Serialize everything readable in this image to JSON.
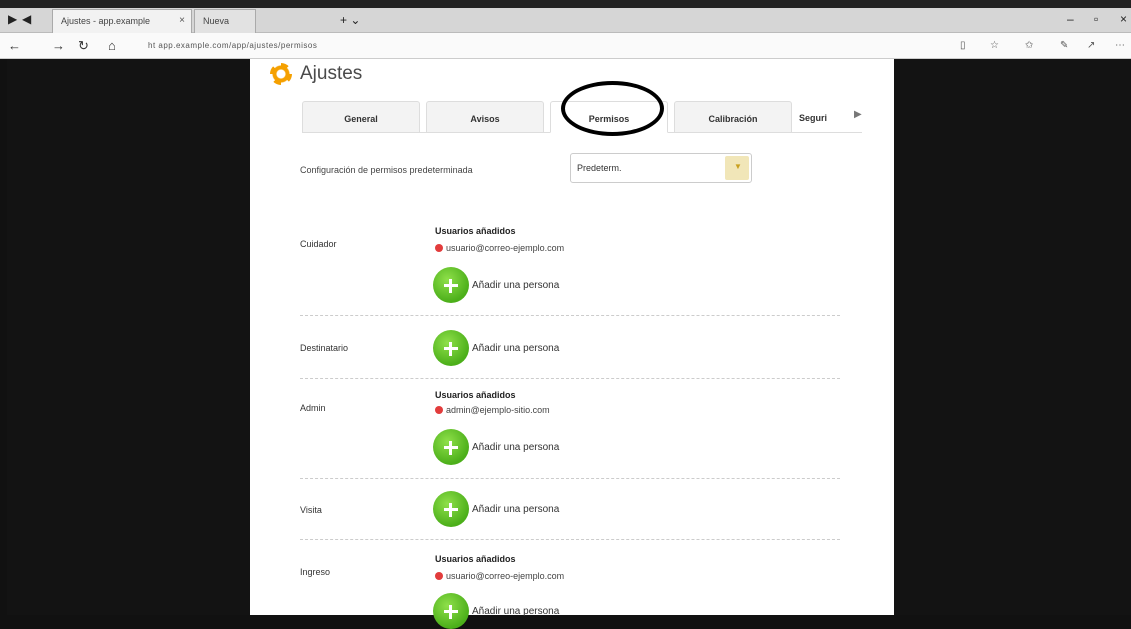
{
  "browser": {
    "tabs": [
      {
        "label": "Ajustes - app.example"
      },
      {
        "label": "Nueva"
      }
    ],
    "url": "ht  app.example.com/app/ajustes/permisos"
  },
  "page": {
    "title": "Ajustes",
    "tabs": [
      "General",
      "Avisos",
      "Permisos",
      "Calibración",
      "Seguri"
    ],
    "active_tab": "Permisos",
    "default_setting_label": "Configuración de permisos predeterminada",
    "default_setting_value": "Predeterm."
  },
  "sections": [
    {
      "label": "Cuidador",
      "subtitle": "Usuarios añadidos",
      "email": "usuario@correo-ejemplo.com",
      "add_label": "Añadir una persona"
    },
    {
      "label": "Destinatario",
      "add_label": "Añadir una persona"
    },
    {
      "label": "Admin",
      "subtitle": "Usuarios añadidos",
      "email": "admin@ejemplo-sitio.com",
      "add_label": "Añadir una persona"
    },
    {
      "label": "Visita",
      "add_label": "Añadir una persona"
    },
    {
      "label": "Ingreso",
      "subtitle": "Usuarios añadidos",
      "email": "usuario@correo-ejemplo.com",
      "add_label": "Añadir una persona"
    }
  ],
  "colors": {
    "accent": "#f5a000",
    "add_green": "#4caf1a",
    "remove_red": "#e23c3c"
  }
}
